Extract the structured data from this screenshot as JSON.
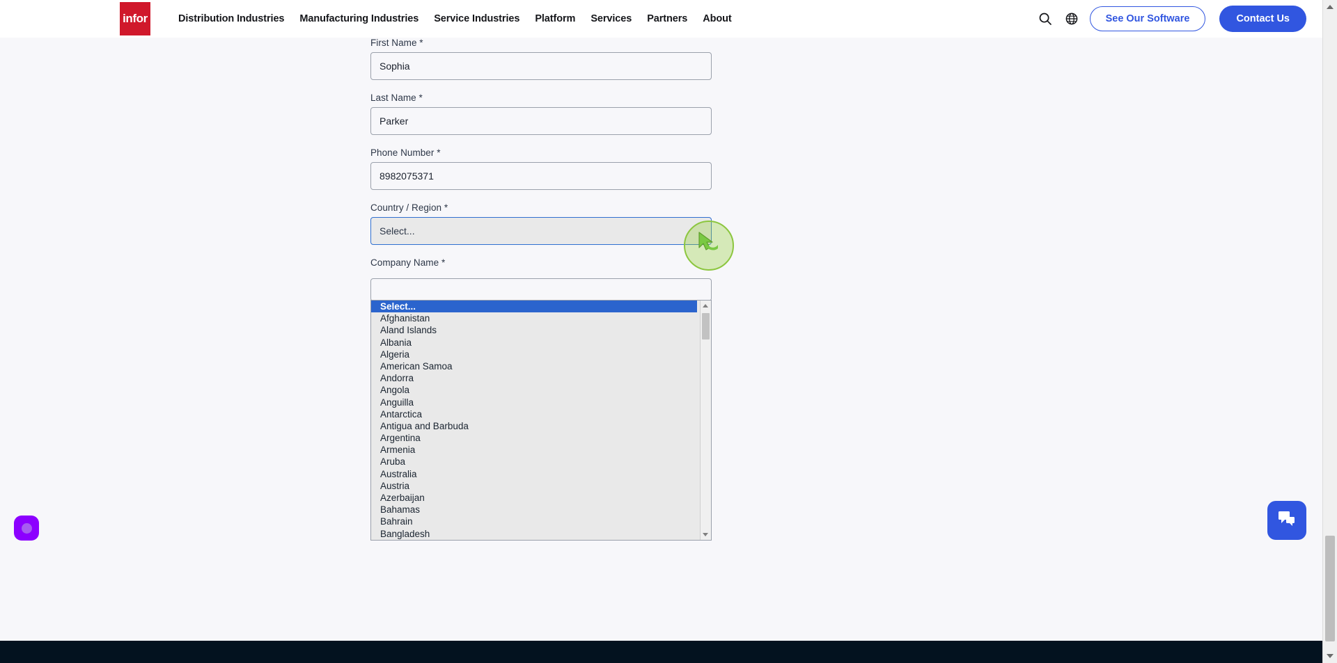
{
  "header": {
    "logo_text": "infor",
    "logo_color": "#d0182b",
    "nav": [
      {
        "label": "Distribution Industries"
      },
      {
        "label": "Manufacturing Industries"
      },
      {
        "label": "Service Industries"
      },
      {
        "label": "Platform"
      },
      {
        "label": "Services"
      },
      {
        "label": "Partners"
      },
      {
        "label": "About"
      }
    ],
    "search_icon": "search-icon",
    "globe_icon": "globe-icon",
    "see_software_label": "See Our Software",
    "contact_label": "Contact Us",
    "accent_color": "#3156e0"
  },
  "form": {
    "fields": [
      {
        "label": "First Name *",
        "value": "Sophia",
        "name": "first-name"
      },
      {
        "label": "Last Name *",
        "value": "Parker",
        "name": "last-name"
      },
      {
        "label": "Phone Number *",
        "value": "8982075371",
        "name": "phone-number"
      }
    ],
    "country": {
      "label": "Country / Region *",
      "value": "Select...",
      "focused": true
    },
    "company": {
      "label": "Company Name *",
      "value": ""
    }
  },
  "dropdown": {
    "open": true,
    "selected": "Select...",
    "options": [
      "Select...",
      "Afghanistan",
      "Aland Islands",
      "Albania",
      "Algeria",
      "American Samoa",
      "Andorra",
      "Angola",
      "Anguilla",
      "Antarctica",
      "Antigua and Barbuda",
      "Argentina",
      "Armenia",
      "Aruba",
      "Australia",
      "Austria",
      "Azerbaijan",
      "Bahamas",
      "Bahrain",
      "Bangladesh"
    ],
    "highlight_color": "#2b64cd"
  },
  "cursor": {
    "type": "arrow-cursor",
    "highlight_color": "#8cc63f"
  },
  "widgets": {
    "accessibility_color": "#8c00ff",
    "chat_icon": "chat-icon",
    "chat_color": "#3156e0"
  }
}
